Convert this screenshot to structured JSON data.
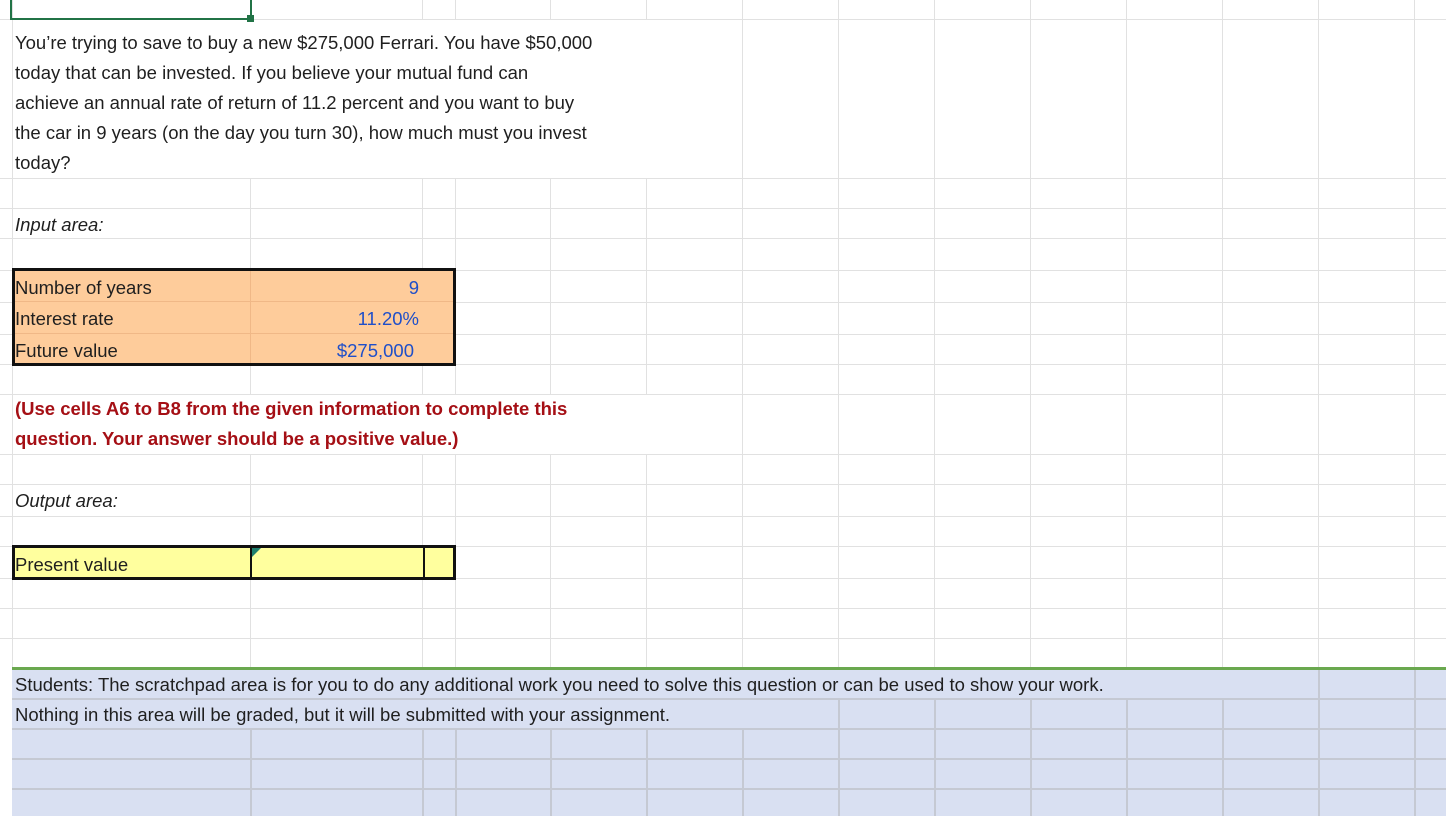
{
  "problem": {
    "lines": [
      "You’re trying to save to buy a new $275,000 Ferrari. You have $50,000",
      "today that can be invested. If you believe your mutual fund can",
      "achieve an annual rate of return of 11.2 percent and you want to buy",
      "the car in 9 years (on the day you turn 30), how much must you invest",
      "today?"
    ]
  },
  "input_area": {
    "heading": "Input area:",
    "rows": [
      {
        "label": "Number of years",
        "value": "9"
      },
      {
        "label": "Interest rate",
        "value": "11.20%"
      },
      {
        "label": "Future value",
        "value": "$275,000"
      }
    ]
  },
  "instruction": {
    "lines": [
      "(Use cells A6 to B8 from the given information to complete this",
      "question. Your answer should be a positive value.)"
    ]
  },
  "output_area": {
    "heading": "Output area:",
    "label": "Present value",
    "value": ""
  },
  "scratchpad": {
    "lines": [
      "Students: The scratchpad area is for you to do any additional work you need to solve this question or can be used to show your work.",
      "Nothing in this area will be graded, but it will be submitted with your assignment."
    ]
  },
  "colors": {
    "input_fill": "#fecc9b",
    "output_fill": "#ffff9e",
    "scratch_fill": "#d9e0f2",
    "value_blue": "#1f4fc9",
    "instruction_red": "#a50f15"
  }
}
